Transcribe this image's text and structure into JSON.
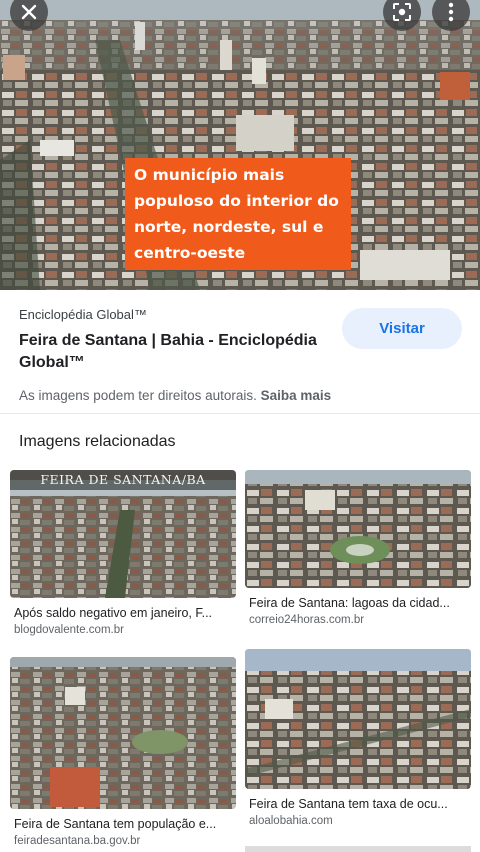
{
  "hero": {
    "caption": "O município mais populoso do interior do norte,  nordeste, sul e centro-oeste",
    "top_buttons": {
      "close_icon": "close-icon",
      "lens_icon": "lens-icon",
      "more_icon": "more-vertical-icon"
    }
  },
  "info": {
    "source_name": "Enciclopédia Global™",
    "page_title": "Feira de Santana | Bahia - Enciclopédia Global™",
    "visit_label": "Visitar",
    "rights_text": "As imagens podem ter direitos autorais.",
    "learn_more": "Saiba mais"
  },
  "related": {
    "title": "Imagens relacionadas",
    "items": [
      {
        "banner": "FEIRA DE SANTANA/BA",
        "caption": "Após saldo negativo em janeiro, F...",
        "domain": "blogdovalente.com.br"
      },
      {
        "caption": "Feira de Santana: lagoas da cidad...",
        "domain": "correio24horas.com.br"
      },
      {
        "caption": "Feira de Santana tem população e...",
        "domain": "feiradesantana.ba.gov.br"
      },
      {
        "caption": "Feira de Santana tem taxa de ocu...",
        "domain": "aloalobahia.com"
      }
    ]
  },
  "colors": {
    "caption_bg": "#f05a1a",
    "visit_bg": "#e8f0fe",
    "visit_text": "#1a73e8"
  }
}
